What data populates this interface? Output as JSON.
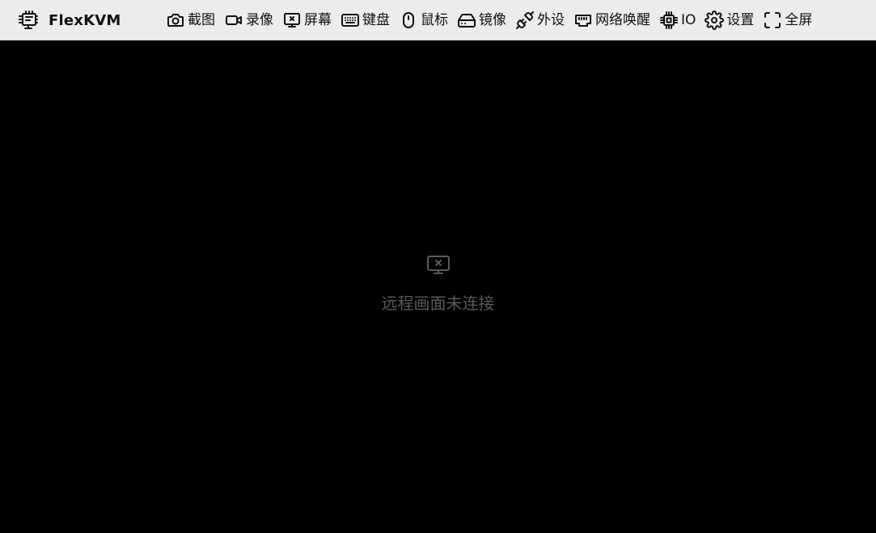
{
  "app": {
    "title": "FlexKVM",
    "logo_icon": "chip-screen-icon"
  },
  "toolbar": {
    "items": [
      {
        "label": "截图",
        "icon": "camera-icon"
      },
      {
        "label": "录像",
        "icon": "video-icon"
      },
      {
        "label": "屏幕",
        "icon": "monitor-x-icon"
      },
      {
        "label": "键盘",
        "icon": "keyboard-icon"
      },
      {
        "label": "鼠标",
        "icon": "mouse-icon"
      },
      {
        "label": "镜像",
        "icon": "disk-drive-icon"
      },
      {
        "label": "外设",
        "icon": "plug-icon"
      },
      {
        "label": "网络唤醒",
        "icon": "ethernet-icon"
      },
      {
        "label": "IO",
        "icon": "cpu-icon"
      },
      {
        "label": "设置",
        "icon": "gear-icon"
      },
      {
        "label": "全屏",
        "icon": "fullscreen-icon"
      }
    ]
  },
  "screen": {
    "status_icon": "monitor-x-icon",
    "status_text": "远程画面未连接"
  },
  "colors": {
    "topbar_bg": "#ececec",
    "screen_bg": "#000000",
    "status_text": "#5a5a5a",
    "icon_stroke": "#111111"
  }
}
